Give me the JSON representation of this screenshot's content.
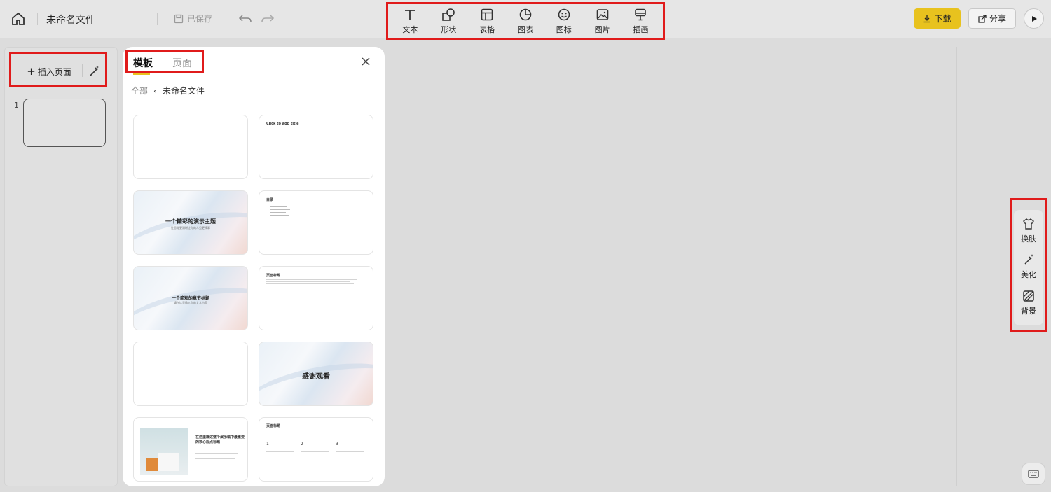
{
  "header": {
    "filename": "未命名文件",
    "saved_label": "已保存",
    "tools": [
      {
        "label": "文本",
        "icon": "text-icon"
      },
      {
        "label": "形状",
        "icon": "shape-icon"
      },
      {
        "label": "表格",
        "icon": "table-icon"
      },
      {
        "label": "图表",
        "icon": "chart-icon"
      },
      {
        "label": "图标",
        "icon": "emoji-icon"
      },
      {
        "label": "图片",
        "icon": "image-icon"
      },
      {
        "label": "插画",
        "icon": "illustration-icon"
      }
    ],
    "download_label": "下载",
    "share_label": "分享"
  },
  "sidebar": {
    "insert_page_label": "插入页面",
    "pages": [
      {
        "number": "1"
      }
    ]
  },
  "panel": {
    "tabs": [
      {
        "label": "模板",
        "active": true
      },
      {
        "label": "页面",
        "active": false
      }
    ],
    "breadcrumb": {
      "root": "全部",
      "current": "未命名文件"
    },
    "cards": {
      "c2_title": "Click to add title",
      "c3_title": "一个精彩的演示主题",
      "c3_sub": "让思路更清晰让你的人见更精彩",
      "c5_title": "一个简短的章节标题",
      "c5_sub": "请在这里输入你的文字内容",
      "c4_title": "目录",
      "c6_title": "页面标题",
      "c8_title": "感谢观看",
      "c9_title": "在这里概述整个演示稿中最重要的核心观点标题",
      "c10_title": "页面标题",
      "c10_nums": [
        "1",
        "2",
        "3"
      ]
    }
  },
  "right_panel": {
    "items": [
      {
        "label": "换肤",
        "icon": "shirt-icon"
      },
      {
        "label": "美化",
        "icon": "magic-wand-icon"
      },
      {
        "label": "背景",
        "icon": "background-icon"
      }
    ]
  },
  "colors": {
    "accent": "#e8c21e",
    "highlight_border": "#e01b1b"
  }
}
